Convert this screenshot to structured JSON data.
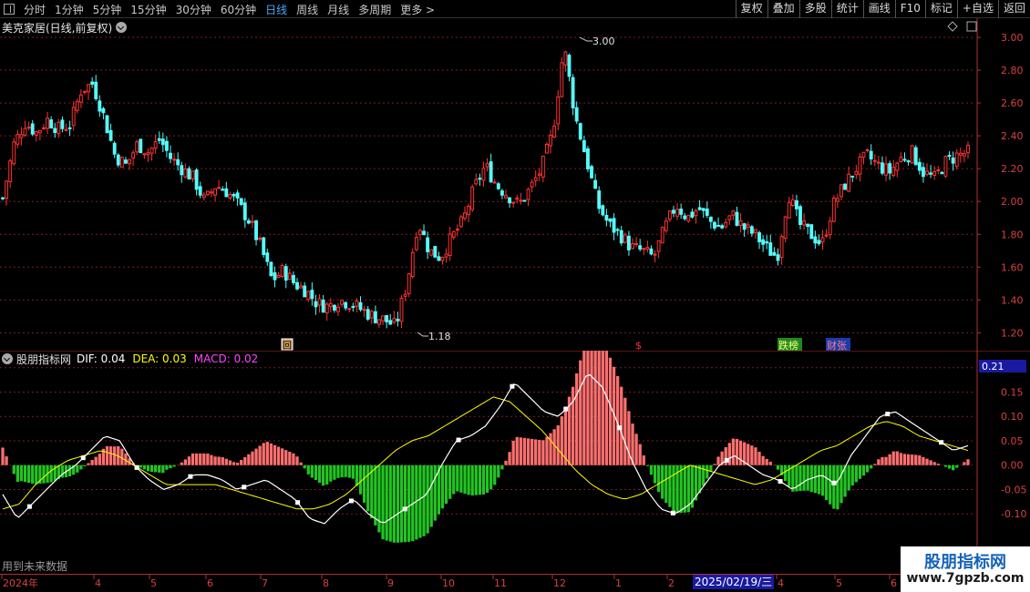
{
  "toolbar": {
    "periods": [
      "分时",
      "1分钟",
      "5分钟",
      "15分钟",
      "30分钟",
      "60分钟",
      "日线",
      "周线",
      "月线",
      "多周期",
      "更多 >"
    ],
    "active_period": "日线",
    "right_buttons": [
      "复权",
      "叠加",
      "多股",
      "统计",
      "画线",
      "F10",
      "标记",
      "+自选",
      "返回"
    ]
  },
  "price_pane": {
    "title": "美克家居(日线,前复权)",
    "high_label": "3.00",
    "low_label": "1.18",
    "y_ticks": [
      "3.00",
      "2.80",
      "2.60",
      "2.40",
      "2.20",
      "2.00",
      "1.80",
      "1.60",
      "1.40",
      "1.20"
    ],
    "markers": [
      "回",
      "$",
      "跌榜",
      "财张"
    ]
  },
  "indicator_pane": {
    "name": "股朋指标网",
    "dif_label": "DIF: 0.04",
    "dea_label": "DEA: 0.03",
    "macd_label": "MACD: 0.02",
    "current_value": "0.21",
    "y_ticks": [
      "0.20",
      "0.15",
      "0.10",
      "0.05",
      "0.00",
      "-0.05",
      "-0.10"
    ],
    "footer_note": "用到未来数据"
  },
  "date_axis": {
    "labels": [
      "2024年",
      "4",
      "5",
      "6",
      "7",
      "8",
      "9",
      "10",
      "11",
      "12",
      "1",
      "2",
      "3",
      "4",
      "5",
      "6"
    ],
    "cursor_date": "2025/02/19/三"
  },
  "watermark": {
    "title": "股朋指标网",
    "url": "www.7gpzb.com"
  },
  "chart_data": {
    "type": "candlestick",
    "symbol_label": "美克家居(日线,前复权)",
    "ylim": [
      1.13,
      3.05
    ],
    "marked_high": 3.0,
    "marked_low": 1.18,
    "close_path": [
      2.02,
      2.35,
      2.48,
      2.42,
      2.5,
      2.44,
      2.47,
      2.68,
      2.72,
      2.52,
      2.28,
      2.22,
      2.35,
      2.3,
      2.38,
      2.26,
      2.2,
      2.14,
      2.0,
      2.1,
      2.06,
      1.98,
      1.88,
      1.72,
      1.52,
      1.58,
      1.5,
      1.46,
      1.38,
      1.36,
      1.4,
      1.38,
      1.34,
      1.3,
      1.28,
      1.24,
      1.5,
      1.88,
      1.7,
      1.66,
      1.78,
      1.88,
      2.08,
      2.22,
      2.1,
      2.04,
      1.98,
      2.08,
      2.2,
      2.42,
      2.95,
      2.52,
      2.26,
      1.98,
      1.86,
      1.8,
      1.72,
      1.7,
      1.66,
      1.84,
      1.98,
      1.9,
      1.96,
      1.88,
      1.84,
      1.92,
      1.84,
      1.8,
      1.72,
      1.66,
      2.05,
      1.86,
      1.8,
      1.74,
      1.98,
      2.1,
      2.2,
      2.28,
      2.22,
      2.18,
      2.26,
      2.3,
      2.18,
      2.14,
      2.24,
      2.28,
      2.3
    ],
    "indicator": {
      "ylim": [
        -0.18,
        0.22
      ],
      "dif": [
        -0.06,
        -0.11,
        -0.08,
        -0.05,
        -0.02,
        0.0,
        0.03,
        0.06,
        0.05,
        0.0,
        -0.03,
        -0.05,
        -0.04,
        -0.02,
        -0.02,
        -0.03,
        -0.05,
        -0.04,
        -0.03,
        -0.05,
        -0.07,
        -0.11,
        -0.12,
        -0.09,
        -0.07,
        -0.1,
        -0.12,
        -0.1,
        -0.08,
        -0.06,
        0.0,
        0.05,
        0.06,
        0.08,
        0.12,
        0.17,
        0.14,
        0.11,
        0.1,
        0.13,
        0.19,
        0.16,
        0.09,
        0.01,
        -0.05,
        -0.09,
        -0.1,
        -0.08,
        -0.04,
        0.0,
        0.02,
        0.0,
        -0.02,
        -0.03,
        -0.05,
        -0.03,
        -0.02,
        -0.04,
        0.02,
        0.06,
        0.1,
        0.11,
        0.09,
        0.07,
        0.05,
        0.03,
        0.04
      ],
      "dea": [
        -0.09,
        -0.08,
        -0.04,
        -0.01,
        0.01,
        0.02,
        0.03,
        0.02,
        0.0,
        -0.02,
        -0.04,
        -0.04,
        -0.04,
        -0.04,
        -0.05,
        -0.06,
        -0.07,
        -0.08,
        -0.09,
        -0.09,
        -0.08,
        -0.06,
        -0.03,
        0.0,
        0.03,
        0.05,
        0.06,
        0.08,
        0.1,
        0.12,
        0.14,
        0.13,
        0.1,
        0.07,
        0.03,
        -0.01,
        -0.04,
        -0.06,
        -0.07,
        -0.06,
        -0.04,
        -0.02,
        0.0,
        -0.01,
        -0.02,
        -0.03,
        -0.04,
        -0.03,
        -0.01,
        0.01,
        0.03,
        0.04,
        0.06,
        0.08,
        0.09,
        0.08,
        0.06,
        0.05,
        0.04,
        0.03
      ]
    }
  }
}
